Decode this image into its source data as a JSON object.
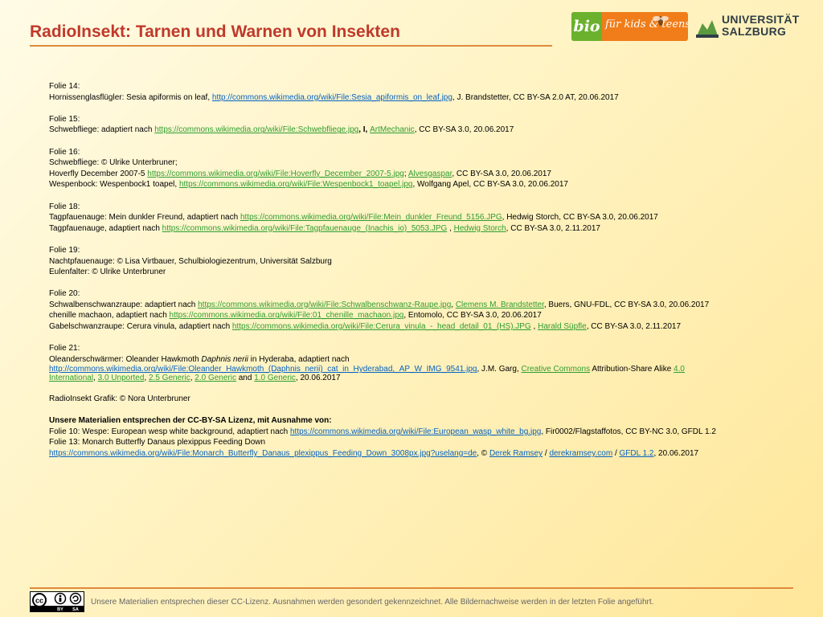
{
  "header": {
    "title": "RadioInsekt: Tarnen und Warnen von Insekten",
    "logo_bio": "bio",
    "logo_kids": "für kids & teens",
    "logo_uni_line1": "UNIVERSITÄT",
    "logo_uni_line2": "SALZBURG"
  },
  "credits": {
    "f14_head": "Folie 14:",
    "f14_a": "Hornissenglasflügler: Sesia apiformis on leaf, ",
    "f14_link": "http://commons.wikimedia.org/wiki/File:Sesia_apiformis_on_leaf.jpg",
    "f14_b": ", J. Brandstetter, CC BY-SA 2.0 AT, 20.06.2017",
    "f15_head": "Folie 15:",
    "f15_a": "Schwebfliege: adaptiert nach ",
    "f15_link": "https://commons.wikimedia.org/wiki/File:Schwebfliege.jpg",
    "f15_sep": ", I, ",
    "f15_author": "ArtMechanic",
    "f15_b": ", CC BY-SA 3.0, 20.06.2017",
    "f16_head": "Folie 16:",
    "f16_l1": "Schwebfliege: © Ulrike Unterbruner;",
    "f16_l2a": "Hoverfly December 2007-5 ",
    "f16_l2link": "https://commons.wikimedia.org/wiki/File:Hoverfly_December_2007-5.jpg",
    "f16_l2sep": "; ",
    "f16_l2author": "Alvesgaspar",
    "f16_l2b": ", CC BY-SA 3.0, 20.06.2017",
    "f16_l3a": "Wespenbock: Wespenbock1 toapel, ",
    "f16_l3link": "https://commons.wikimedia.org/wiki/File:Wespenbock1_toapel.jpg",
    "f16_l3b": ",  Wolfgang Apel, CC BY-SA 3.0, 20.06.2017",
    "f18_head": "Folie 18:",
    "f18_l1a": "Tagpfauenauge: Mein dunkler Freund,  adaptiert nach ",
    "f18_l1link": "https://commons.wikimedia.org/wiki/File:Mein_dunkler_Freund_5156.JPG",
    "f18_l1b": ", Hedwig Storch, CC BY-SA 3.0, 20.06.2017",
    "f18_l2a": "Tagpfauenauge, adaptiert nach ",
    "f18_l2link": "https://commons.wikimedia.org/wiki/File:Tagpfauenauge_(Inachis_io)_5053.JPG",
    "f18_l2sep": " , ",
    "f18_l2author": "Hedwig Storch",
    "f18_l2b": ", CC BY-SA 3.0, 2.11.2017",
    "f19_head": "Folie 19:",
    "f19_l1": "Nachtpfauenauge: © Lisa Virtbauer,  Schulbiologiezentrum, Universität Salzburg",
    "f19_l2": "Eulenfalter: © Ulrike Unterbruner",
    "f20_head": "Folie 20:",
    "f20_l1a": "Schwalbenschwanzraupe: adaptiert nach ",
    "f20_l1link": "https://commons.wikimedia.org/wiki/File:Schwalbenschwanz-Raupe.jpg",
    "f20_l1sep": ", ",
    "f20_l1author": "Clemens M. Brandstetter",
    "f20_l1b": ", Buers, GNU-FDL, CC BY-SA 3.0, 20.06.2017",
    "f20_l2a": "chenille machaon, adaptiert nach ",
    "f20_l2link": "https://commons.wikimedia.org/wiki/File:01_chenille_machaon.jpg",
    "f20_l2b": ", Entomolo, CC BY-SA 3.0, 20.06.2017",
    "f20_l3a": "Gabelschwanzraupe: Cerura vinula, adaptiert nach ",
    "f20_l3link": "https://commons.wikimedia.org/wiki/File:Cerura_vinula_-_head_detail_01_(HS).JPG",
    "f20_l3sep": " , ",
    "f20_l3author": "Harald Süpfle",
    "f20_l3b": ", CC BY-SA 3.0, 2.11.2017",
    "f21_head": "Folie 21:",
    "f21_a": "Oleanderschwärmer: Oleander Hawkmoth ",
    "f21_italic": "Daphnis nerii",
    "f21_b": " in Hyderaba, adaptiert nach",
    "f21_link": "http://commons.wikimedia.org/wiki/File:Oleander_Hawkmoth_(Daphnis_nerii)_cat_in_Hyderabad,_AP_W_IMG_9541.jpg",
    "f21_c": ",  J.M. Garg, ",
    "f21_cc": "Creative Commons",
    "f21_d": " Attribution-Share Alike ",
    "f21_v40": "4.0 International",
    "f21_s1": ", ",
    "f21_v30": "3.0 Unported",
    "f21_s2": ", ",
    "f21_v25": "2.5 Generic",
    "f21_s3": ", ",
    "f21_v20": "2.0 Generic",
    "f21_and": " and ",
    "f21_v10": "1.0 Generic",
    "f21_e": ", 20.06.2017",
    "grafik": "RadioInsekt Grafik: © Nora Unterbruner",
    "exc_head": "Unsere Materialien entsprechen der CC-BY-SA Lizenz, mit Ausnahme von:",
    "f10_a": "Folie 10: Wespe: European wesp white background, adaptiert nach ",
    "f10_link": "https://commons.wikimedia.org/wiki/File:European_wasp_white_bg.jpg",
    "f10_b": ", Fir0002/Flagstaffotos, CC BY-NC 3.0, GFDL 1.2",
    "f13_line": "Folie 13: Monarch Butterfly Danaus plexippus Feeding Down",
    "f13_link": "https://commons.wikimedia.org/wiki/File:Monarch_Butterfly_Danaus_plexippus_Feeding_Down_3008px.jpg?uselang=de",
    "f13_a": ", © ",
    "f13_author": "Derek Ramsey",
    "f13_s1": " / ",
    "f13_site": "derekramsey.com",
    "f13_s2": " / ",
    "f13_gfdl": "GFDL 1.2",
    "f13_b": ", 20.06.2017"
  },
  "footer": {
    "cc_by": "BY",
    "cc_sa": "SA",
    "text": "Unsere Materialien entsprechen dieser CC-Lizenz. Ausnahmen werden gesondert gekennzeichnet. Alle Bildernachweise werden in der letzten Folie angeführt."
  },
  "colors": {
    "title": "#c0392b",
    "rule": "#e08a3c",
    "link": "#0563c1",
    "link_green": "#2f9e2f"
  }
}
